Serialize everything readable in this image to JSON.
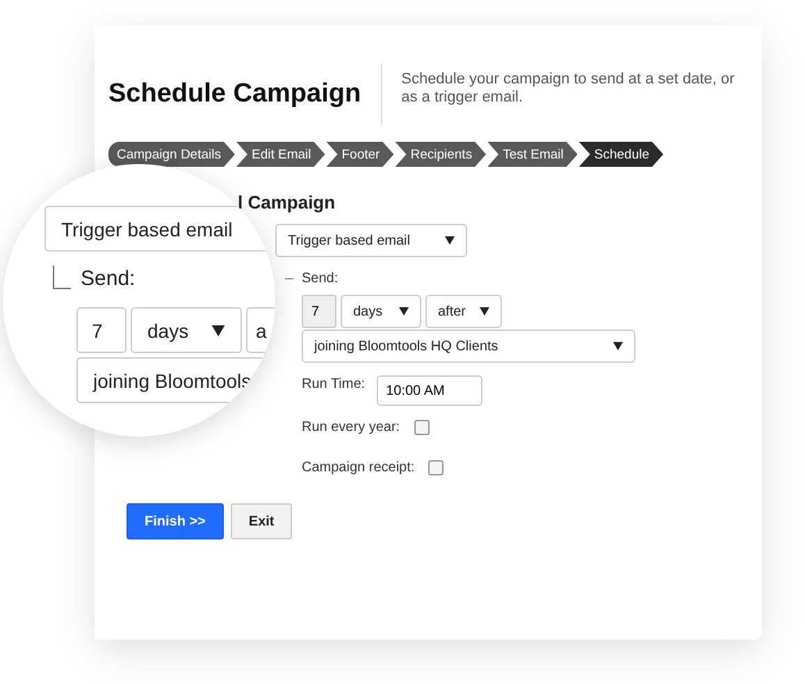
{
  "header": {
    "title": "Schedule Campaign",
    "description": "Schedule your campaign to send at a set date, or as a trigger email."
  },
  "steps": [
    {
      "label": "Campaign Details",
      "selected": false
    },
    {
      "label": "Edit Email",
      "selected": false
    },
    {
      "label": "Footer",
      "selected": false
    },
    {
      "label": "Recipients",
      "selected": false
    },
    {
      "label": "Test Email",
      "selected": false
    },
    {
      "label": "Schedule",
      "selected": true
    }
  ],
  "form": {
    "heading": "l Campaign",
    "trigger_type": "Trigger based email",
    "send_label": "Send:",
    "amount": "7",
    "unit": "days",
    "relation": "after",
    "event": "joining Bloomtools HQ Clients",
    "run_time_label": "Run Time:",
    "run_time": "10:00 AM",
    "options": [
      {
        "label": "Run every year:",
        "checked": false
      },
      {
        "label": "Campaign receipt:",
        "checked": false
      }
    ]
  },
  "buttons": [
    {
      "label": "Finish >>",
      "kind": "primary"
    },
    {
      "label": "Exit",
      "kind": "secondary"
    }
  ],
  "magnifier": {
    "trigger_type": "Trigger based email",
    "send_label": "Send:",
    "amount": "7",
    "unit": "days",
    "relation": "a",
    "event": "joining Bloomtools"
  }
}
